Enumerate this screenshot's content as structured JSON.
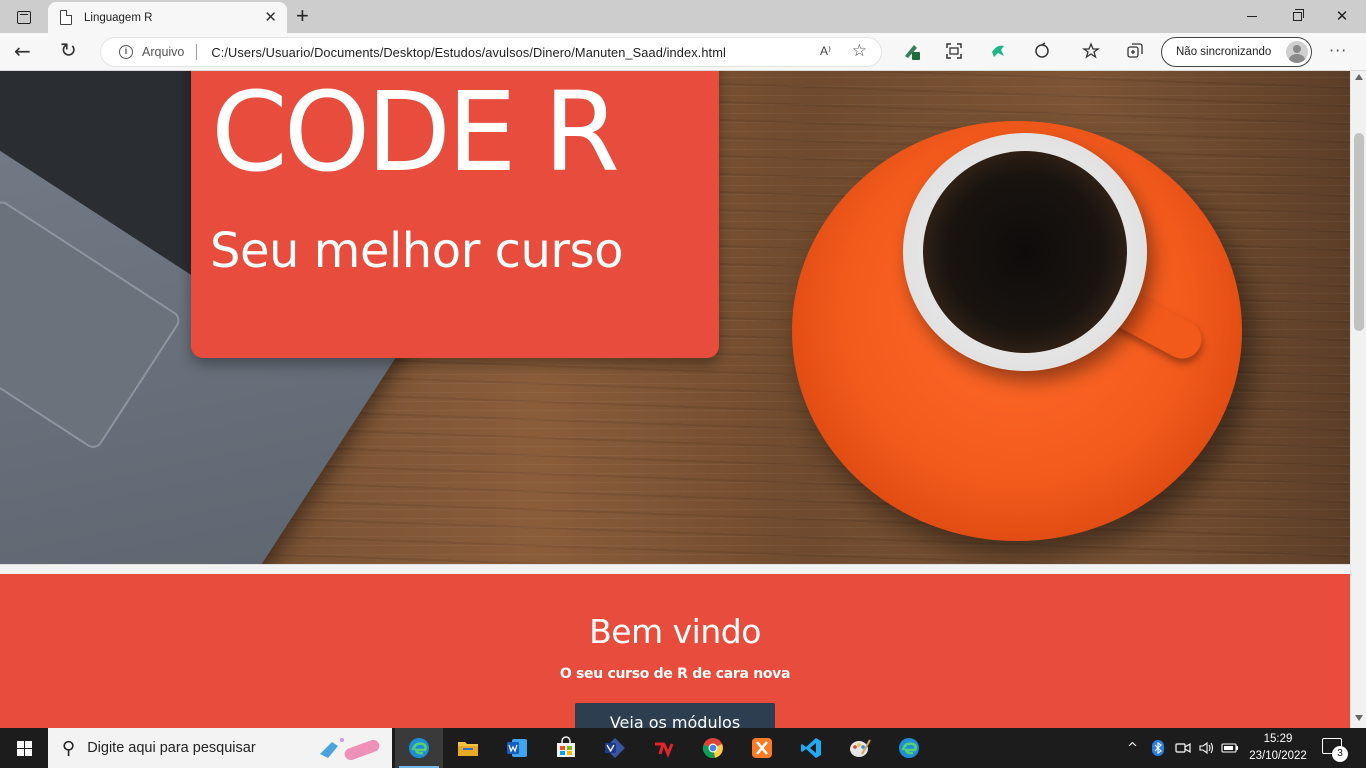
{
  "browser": {
    "tab": {
      "title": "Linguagem R",
      "close_glyph": "✕"
    },
    "new_tab_glyph": "+",
    "window_controls": {
      "close_glyph": "✕"
    },
    "address_bar": {
      "scheme_label": "Arquivo",
      "url": "C:/Users/Usuario/Documents/Desktop/Estudos/avulsos/Dinero/Manuten_Saad/index.html",
      "read_aloud_glyph": "A⁾"
    },
    "profile": {
      "label": "Não sincronizando"
    },
    "more_glyph": "···"
  },
  "page": {
    "hero": {
      "title": "CODE R",
      "subtitle": "Seu melhor curso"
    },
    "welcome": {
      "title": "Bem vindo",
      "subtitle": "O seu curso de R de cara nova",
      "button_label": "Veja os módulos"
    }
  },
  "taskbar": {
    "search_placeholder": "Digite aqui para pesquisar",
    "apps": [
      "edge-icon",
      "file-explorer-icon",
      "word-icon",
      "store-icon",
      "visio-icon",
      "game-icon",
      "chrome-icon",
      "xampp-icon",
      "vscode-icon",
      "paint-icon",
      "edge-alt-icon"
    ],
    "clock": {
      "time": "15:29",
      "date": "23/10/2022"
    },
    "notifications_count": "3"
  },
  "colors": {
    "accent_red": "#e74c3c",
    "button_dark": "#2c3e50",
    "saucer_orange": "#f25a1c"
  }
}
